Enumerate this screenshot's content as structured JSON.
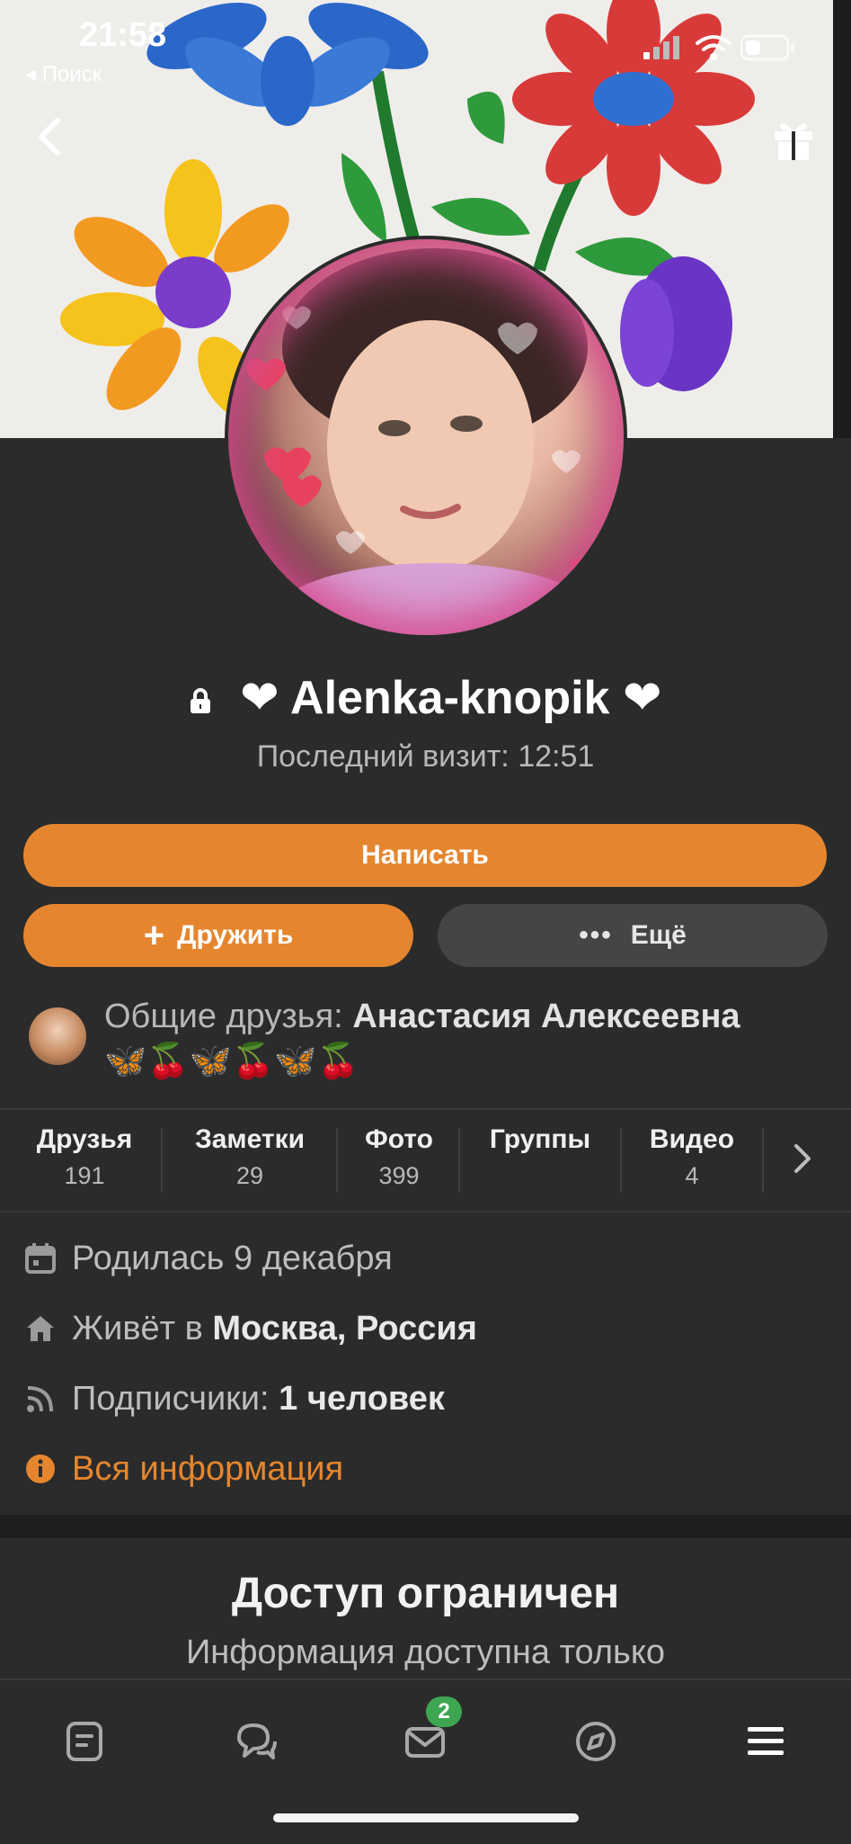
{
  "status_bar": {
    "time": "21:58",
    "back_app": "◂ Поиск"
  },
  "profile": {
    "name": "Alenka-knopik",
    "name_prefix": "❤︎",
    "name_suffix": "❤︎",
    "last_visit": "Последний визит: 12:51"
  },
  "actions": {
    "write": "Написать",
    "friend": "Дружить",
    "more": "Ещё"
  },
  "mutual_friends": {
    "label": "Общие друзья:",
    "name": "Анастасия Алексеевна",
    "emoji": "🦋🍒🦋🍒🦋🍒"
  },
  "tabs": [
    {
      "title": "Друзья",
      "count": "191"
    },
    {
      "title": "Заметки",
      "count": "29"
    },
    {
      "title": "Фото",
      "count": "399"
    },
    {
      "title": "Группы",
      "count": ""
    },
    {
      "title": "Видео",
      "count": "4"
    }
  ],
  "info": {
    "born": "Родилась 9 декабря",
    "lives_prefix": "Живёт в",
    "lives_city": "Москва, Россия",
    "subs_prefix": "Подписчики:",
    "subs_value": "1 человек",
    "all_info": "Вся информация"
  },
  "restricted": {
    "title": "Доступ ограничен",
    "subtitle": "Информация доступна только"
  },
  "bottom_nav": {
    "messages_badge": "2"
  },
  "colors": {
    "accent": "#e5862f",
    "background": "#2b2b2b",
    "badge": "#3ea651"
  }
}
